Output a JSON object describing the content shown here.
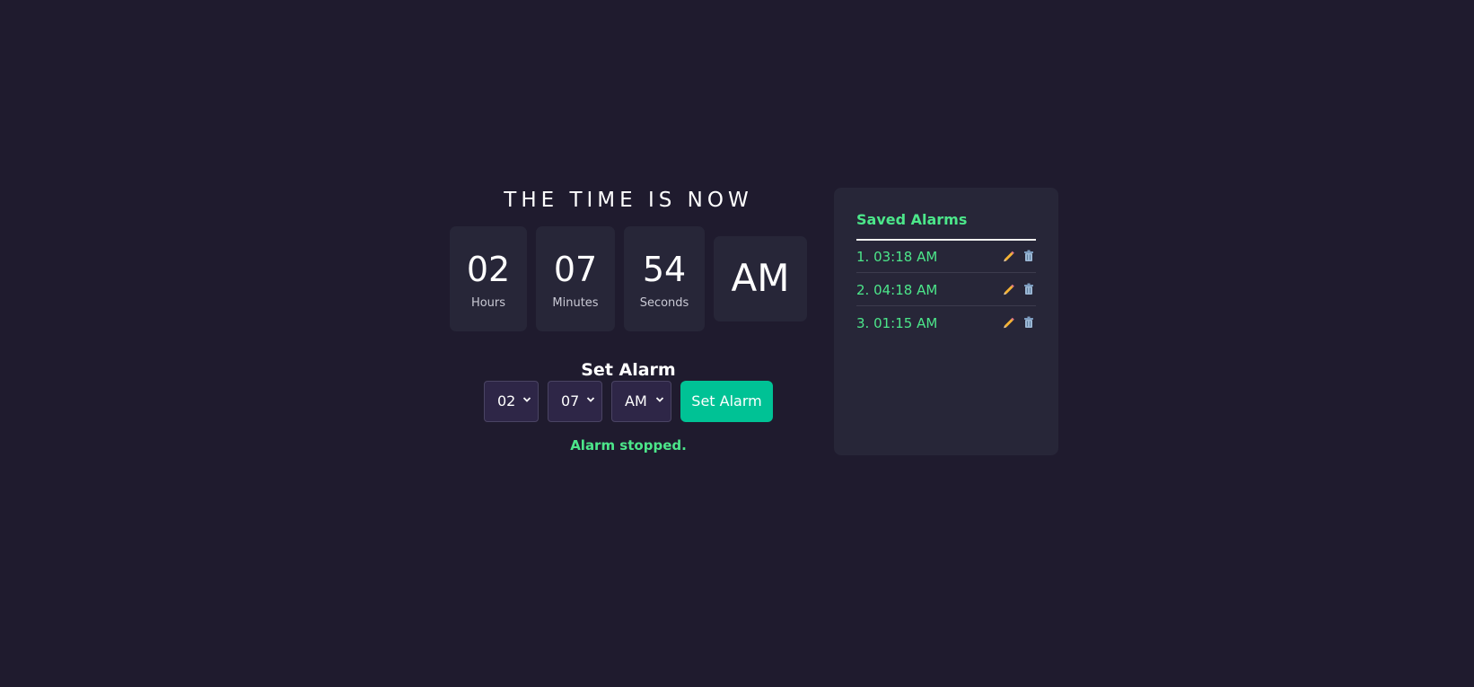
{
  "clock": {
    "title": "THE TIME IS NOW",
    "hours": "02",
    "hours_label": "Hours",
    "minutes": "07",
    "minutes_label": "Minutes",
    "seconds": "54",
    "seconds_label": "Seconds",
    "period": "AM"
  },
  "alarm_form": {
    "heading": "Set Alarm",
    "hour_value": "02",
    "minute_value": "07",
    "period_value": "AM",
    "button_label": "Set Alarm",
    "status": "Alarm stopped."
  },
  "saved": {
    "title": "Saved Alarms",
    "items": [
      {
        "label": "1. 03:18 AM"
      },
      {
        "label": "2. 04:18 AM"
      },
      {
        "label": "3. 01:15 AM"
      }
    ]
  },
  "icons": {
    "edit": "pencil-icon",
    "delete": "trash-icon",
    "dropdown": "chevron-down-icon"
  },
  "colors": {
    "background": "#1f1b2e",
    "panel": "#272638",
    "accent": "#00c295",
    "success_text": "#4ce68a",
    "select_bg": "#2e2647"
  }
}
